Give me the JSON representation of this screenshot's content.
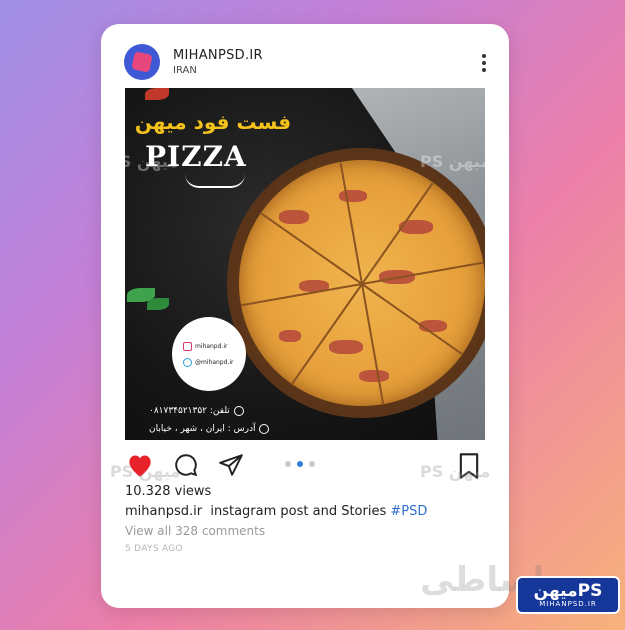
{
  "header": {
    "username": "MIHANPSD.IR",
    "location": "IRAN"
  },
  "post": {
    "title_fa": "فست فود میهن",
    "title_en": "PIZZA",
    "social": [
      {
        "icon": "instagram-icon",
        "handle": "mihanpd.ir"
      },
      {
        "icon": "telegram-icon",
        "handle": "@mihanpd.ir"
      }
    ],
    "phone": "تلفن: ۰۸۱۷۳۴۵۲۱۳۵۲",
    "address": "آدرس : ایران ، شهر ، خیابان"
  },
  "actions": {
    "liked": true,
    "carousel_index": 1,
    "carousel_count": 3
  },
  "footer": {
    "views": "10.328 views",
    "caption_user": "mihanpsd.ir",
    "caption_text": "instagram post and Stories",
    "caption_tag": "#PSD",
    "comments_link": "View all 328 comments",
    "timestamp": "5 DAYS AGO"
  },
  "watermarks": {
    "side_text": "PS میهن",
    "center_text": "پاساطی"
  },
  "logo": {
    "main": "میهنPS",
    "sub": "MIHANPSD.IR"
  },
  "colors": {
    "heart": "#e8222b",
    "tag": "#2f6fcf",
    "active_dot": "#2f7fd8",
    "logo_bg": "#16379a"
  }
}
